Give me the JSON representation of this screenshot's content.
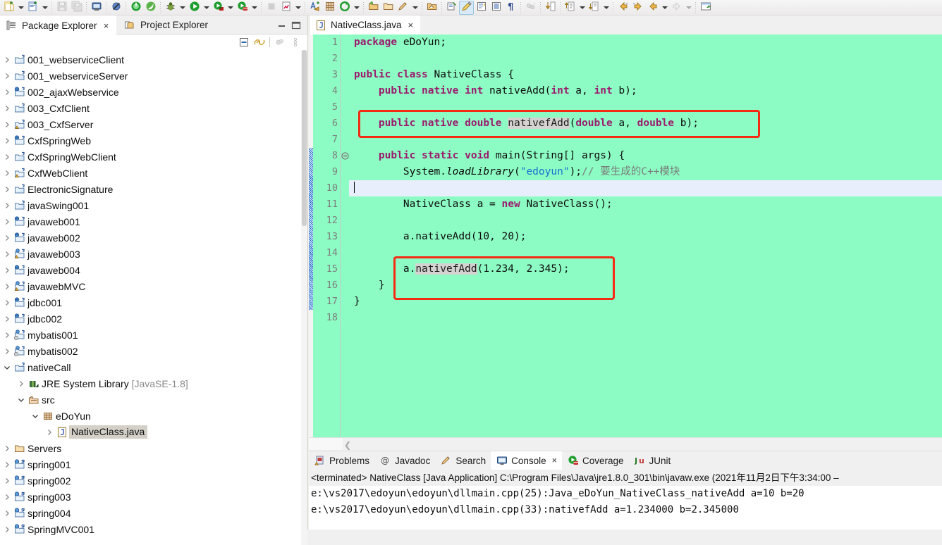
{
  "toolbar": {
    "groups": [
      {
        "buttons": [
          {
            "name": "new-wizard",
            "icon": "new-file-icon",
            "arrow": true
          },
          {
            "name": "new-java-class",
            "icon": "new-class-icon",
            "arrow": true
          }
        ]
      },
      {
        "buttons": [
          {
            "name": "save",
            "icon": "save-icon",
            "arrow": false,
            "disabled": true
          },
          {
            "name": "save-all",
            "icon": "save-all-icon",
            "arrow": false,
            "disabled": true
          }
        ]
      },
      {
        "buttons": [
          {
            "name": "print",
            "icon": "print-icon",
            "arrow": false
          }
        ]
      },
      {
        "buttons": [
          {
            "name": "toggle-breakpoint",
            "icon": "skip-breakpoints-icon",
            "arrow": false
          }
        ]
      },
      {
        "buttons": [
          {
            "name": "terminate",
            "icon": "power-green-icon",
            "arrow": false
          },
          {
            "name": "spring-boot",
            "icon": "spring-leaf-icon",
            "arrow": false
          }
        ]
      },
      {
        "buttons": [
          {
            "name": "debug",
            "icon": "debug-bug-icon",
            "arrow": true
          },
          {
            "name": "run",
            "icon": "run-play-icon",
            "arrow": true
          },
          {
            "name": "run-external-tools",
            "icon": "run-tools-icon",
            "arrow": true
          },
          {
            "name": "coverage",
            "icon": "coverage-icon",
            "arrow": true
          }
        ]
      },
      {
        "buttons": [
          {
            "name": "stop",
            "icon": "stop-square-icon",
            "arrow": false,
            "disabled": true
          },
          {
            "name": "profile",
            "icon": "profile-icon",
            "arrow": true
          }
        ]
      },
      {
        "buttons": [
          {
            "name": "new-annotation",
            "icon": "new-annotation-icon",
            "arrow": false
          },
          {
            "name": "new-package",
            "icon": "new-package-icon",
            "arrow": false
          },
          {
            "name": "refresh-green",
            "icon": "refresh-circle-icon",
            "arrow": true
          }
        ]
      },
      {
        "buttons": [
          {
            "name": "open-type",
            "icon": "open-type-icon",
            "arrow": false
          },
          {
            "name": "open-task",
            "icon": "open-folder-icon",
            "arrow": false
          },
          {
            "name": "search",
            "icon": "search-pen-icon",
            "arrow": true
          }
        ]
      },
      {
        "buttons": [
          {
            "name": "open-resource",
            "icon": "open-resource-icon",
            "arrow": false
          }
        ]
      },
      {
        "buttons": [
          {
            "name": "toggle-mark-occurrences",
            "icon": "mark-occurrences-icon",
            "arrow": false
          },
          {
            "name": "highlight-pen",
            "icon": "highlight-pen-icon",
            "arrow": false,
            "selected": true
          },
          {
            "name": "show-whitespace-ruler",
            "icon": "ruler-icon",
            "arrow": false
          },
          {
            "name": "show-source-list",
            "icon": "source-list-icon",
            "arrow": false
          },
          {
            "name": "show-whitespace",
            "icon": "pilcrow-icon",
            "arrow": false
          }
        ]
      },
      {
        "buttons": [
          {
            "name": "link-editor",
            "icon": "link-editor-icon",
            "arrow": false,
            "disabled": true
          }
        ]
      },
      {
        "buttons": [
          {
            "name": "collapse-import",
            "icon": "collapse-down-icon",
            "arrow": false
          }
        ]
      },
      {
        "buttons": [
          {
            "name": "next-annotation",
            "icon": "next-annotation-icon",
            "arrow": true
          },
          {
            "name": "previous-annotation",
            "icon": "prev-annotation-icon",
            "arrow": true
          }
        ]
      },
      {
        "buttons": [
          {
            "name": "back-history",
            "icon": "back-arrow-star-icon",
            "arrow": false
          },
          {
            "name": "forward-history",
            "icon": "forward-arrow-star-icon",
            "arrow": false
          },
          {
            "name": "back",
            "icon": "back-arrow-icon",
            "arrow": true
          },
          {
            "name": "forward",
            "icon": "forward-arrow-icon",
            "arrow": true,
            "disabled": true
          }
        ]
      },
      {
        "buttons": [
          {
            "name": "open-perspective",
            "icon": "open-perspective-icon",
            "arrow": false
          }
        ]
      }
    ]
  },
  "left_panel": {
    "tabs": [
      {
        "label": "Package Explorer",
        "icon": "package-explorer-icon",
        "active": true,
        "closable": true
      },
      {
        "label": "Project Explorer",
        "icon": "project-explorer-icon",
        "active": false,
        "closable": false
      }
    ],
    "view_buttons": [
      {
        "name": "minimize-view-button",
        "icon": "minimize-icon"
      },
      {
        "name": "maximize-view-button",
        "icon": "maximize-icon"
      }
    ],
    "view_toolbar": [
      {
        "name": "collapse-all-button",
        "icon": "collapse-all-icon"
      },
      {
        "name": "link-with-editor-button",
        "icon": "link-with-editor-icon"
      },
      {
        "name": "focus-on-active-task-button",
        "icon": "focus-task-icon"
      },
      {
        "name": "view-menu-button",
        "icon": "view-menu-icon"
      }
    ],
    "tree": [
      {
        "label": "001_webserviceClient",
        "icon": "java-project-icon",
        "indent": 0,
        "state": "collapsed"
      },
      {
        "label": "001_webserviceServer",
        "icon": "java-project-icon",
        "indent": 0,
        "state": "collapsed"
      },
      {
        "label": "002_ajaxWebservice",
        "icon": "web-project-icon",
        "indent": 0,
        "state": "collapsed"
      },
      {
        "label": "003_CxfClient",
        "icon": "java-project-icon",
        "indent": 0,
        "state": "collapsed"
      },
      {
        "label": "003_CxfServer",
        "icon": "java-project-warn-icon",
        "indent": 0,
        "state": "collapsed"
      },
      {
        "label": "CxfSpringWeb",
        "icon": "web-project-icon",
        "indent": 0,
        "state": "collapsed"
      },
      {
        "label": "CxfSpringWebClient",
        "icon": "java-project-icon",
        "indent": 0,
        "state": "collapsed"
      },
      {
        "label": "CxfWebClient",
        "icon": "java-project-warn-icon",
        "indent": 0,
        "state": "collapsed"
      },
      {
        "label": "ElectronicSignature",
        "icon": "java-project-icon",
        "indent": 0,
        "state": "collapsed"
      },
      {
        "label": "javaSwing001",
        "icon": "java-project-icon",
        "indent": 0,
        "state": "collapsed"
      },
      {
        "label": "javaweb001",
        "icon": "web-project-icon",
        "indent": 0,
        "state": "collapsed"
      },
      {
        "label": "javaweb002",
        "icon": "web-project-icon",
        "indent": 0,
        "state": "collapsed"
      },
      {
        "label": "javaweb003",
        "icon": "web-project-warn-icon",
        "indent": 0,
        "state": "collapsed"
      },
      {
        "label": "javaweb004",
        "icon": "web-project-icon",
        "indent": 0,
        "state": "collapsed"
      },
      {
        "label": "javawebMVC",
        "icon": "web-project-warn-icon",
        "indent": 0,
        "state": "collapsed"
      },
      {
        "label": "jdbc001",
        "icon": "web-project-icon",
        "indent": 0,
        "state": "collapsed"
      },
      {
        "label": "jdbc002",
        "icon": "web-project-icon",
        "indent": 0,
        "state": "collapsed"
      },
      {
        "label": "mybatis001",
        "icon": "web-project-info-icon",
        "indent": 0,
        "state": "collapsed"
      },
      {
        "label": "mybatis002",
        "icon": "web-project-info-icon",
        "indent": 0,
        "state": "collapsed"
      },
      {
        "label": "nativeCall",
        "icon": "java-project-icon",
        "indent": 0,
        "state": "expanded"
      },
      {
        "label": "JRE System Library",
        "suffix": " [JavaSE-1.8]",
        "icon": "jre-library-icon",
        "indent": 1,
        "state": "collapsed"
      },
      {
        "label": "src",
        "icon": "source-folder-icon",
        "indent": 1,
        "state": "expanded"
      },
      {
        "label": "eDoYun",
        "icon": "package-icon",
        "indent": 2,
        "state": "expanded"
      },
      {
        "label": "NativeClass.java",
        "icon": "java-file-icon",
        "indent": 3,
        "state": "collapsed",
        "selected": true
      },
      {
        "label": "Servers",
        "icon": "folder-icon",
        "indent": 0,
        "state": "collapsed"
      },
      {
        "label": "spring001",
        "icon": "spring-project-icon",
        "indent": 0,
        "state": "collapsed"
      },
      {
        "label": "spring002",
        "icon": "spring-project-icon",
        "indent": 0,
        "state": "collapsed"
      },
      {
        "label": "spring003",
        "icon": "spring-project-icon",
        "indent": 0,
        "state": "collapsed"
      },
      {
        "label": "spring004",
        "icon": "spring-project-icon",
        "indent": 0,
        "state": "collapsed"
      },
      {
        "label": "SpringMVC001",
        "icon": "spring-project-icon",
        "indent": 0,
        "state": "collapsed"
      }
    ]
  },
  "editor": {
    "tab": {
      "label": "NativeClass.java",
      "icon": "java-file-icon",
      "close": "×"
    },
    "background_color": "#8dfcc4",
    "current_line": 10,
    "current_line_color": "#e8eefc",
    "highlight_boxes_color": "#f42a12",
    "changed_lines": {
      "from": 8,
      "to": 17,
      "color": "#0d5fc8"
    },
    "line_count": 18,
    "lines": [
      {
        "n": 1,
        "tokens": [
          {
            "t": "package",
            "c": "kw"
          },
          {
            "t": " eDoYun;",
            "c": "plain"
          }
        ]
      },
      {
        "n": 2,
        "tokens": []
      },
      {
        "n": 3,
        "tokens": [
          {
            "t": "public class",
            "c": "kw"
          },
          {
            "t": " NativeClass {",
            "c": "plain"
          }
        ]
      },
      {
        "n": 4,
        "tokens": [
          {
            "t": "    ",
            "c": "plain"
          },
          {
            "t": "public native int",
            "c": "kw"
          },
          {
            "t": " nativeAdd(",
            "c": "plain"
          },
          {
            "t": "int",
            "c": "kw"
          },
          {
            "t": " a, ",
            "c": "plain"
          },
          {
            "t": "int",
            "c": "kw"
          },
          {
            "t": " b);",
            "c": "plain"
          }
        ]
      },
      {
        "n": 5,
        "tokens": []
      },
      {
        "n": 6,
        "tokens": [
          {
            "t": "    ",
            "c": "plain"
          },
          {
            "t": "public native double",
            "c": "kw"
          },
          {
            "t": " ",
            "c": "plain"
          },
          {
            "t": "nativefAdd",
            "c": "occ"
          },
          {
            "t": "(",
            "c": "plain"
          },
          {
            "t": "double",
            "c": "kw"
          },
          {
            "t": " a, ",
            "c": "plain"
          },
          {
            "t": "double",
            "c": "kw"
          },
          {
            "t": " b);",
            "c": "plain"
          }
        ]
      },
      {
        "n": 7,
        "tokens": []
      },
      {
        "n": 8,
        "tokens": [
          {
            "t": "    ",
            "c": "plain"
          },
          {
            "t": "public static void",
            "c": "kw"
          },
          {
            "t": " main(String[] args) {",
            "c": "plain"
          }
        ],
        "fold": true
      },
      {
        "n": 9,
        "tokens": [
          {
            "t": "        System.",
            "c": "plain"
          },
          {
            "t": "loadLibrary",
            "c": "ital"
          },
          {
            "t": "(",
            "c": "plain"
          },
          {
            "t": "\"edoyun\"",
            "c": "str"
          },
          {
            "t": ");",
            "c": "plain"
          },
          {
            "t": "// 要生成的C++模块",
            "c": "cmt"
          }
        ]
      },
      {
        "n": 10,
        "tokens": [],
        "current": true
      },
      {
        "n": 11,
        "tokens": [
          {
            "t": "        NativeClass a = ",
            "c": "plain"
          },
          {
            "t": "new",
            "c": "kw"
          },
          {
            "t": " NativeClass();",
            "c": "plain"
          }
        ]
      },
      {
        "n": 12,
        "tokens": []
      },
      {
        "n": 13,
        "tokens": [
          {
            "t": "        a.nativeAdd(10, 20);",
            "c": "plain"
          }
        ]
      },
      {
        "n": 14,
        "tokens": []
      },
      {
        "n": 15,
        "tokens": [
          {
            "t": "        a.",
            "c": "plain"
          },
          {
            "t": "nativefAdd",
            "c": "occ"
          },
          {
            "t": "(1.234, 2.345);",
            "c": "plain"
          }
        ]
      },
      {
        "n": 16,
        "tokens": [
          {
            "t": "    }",
            "c": "plain"
          }
        ]
      },
      {
        "n": 17,
        "tokens": [
          {
            "t": "}",
            "c": "plain"
          }
        ]
      },
      {
        "n": 18,
        "tokens": []
      }
    ],
    "hscroll_arrow": "❮"
  },
  "console": {
    "tabs": [
      {
        "label": "Problems",
        "icon": "problems-icon",
        "active": false,
        "closable": false
      },
      {
        "label": "Javadoc",
        "icon": "javadoc-icon",
        "active": false,
        "closable": false
      },
      {
        "label": "Search",
        "icon": "search-icon",
        "active": false,
        "closable": false
      },
      {
        "label": "Console",
        "icon": "console-icon",
        "active": true,
        "closable": true
      },
      {
        "label": "Coverage",
        "icon": "coverage-icon",
        "active": false,
        "closable": false
      },
      {
        "label": "JUnit",
        "icon": "junit-icon",
        "active": false,
        "closable": false
      }
    ],
    "header": "<terminated> NativeClass [Java Application] C:\\Program Files\\Java\\jre1.8.0_301\\bin\\javaw.exe (2021年11月2日下午3:34:00 –",
    "output": [
      "e:\\vs2017\\edoyun\\edoyun\\dllmain.cpp(25):Java_eDoYun_NativeClass_nativeAdd a=10 b=20",
      "e:\\vs2017\\edoyun\\edoyun\\dllmain.cpp(33):nativefAdd a=1.234000 b=2.345000"
    ]
  }
}
